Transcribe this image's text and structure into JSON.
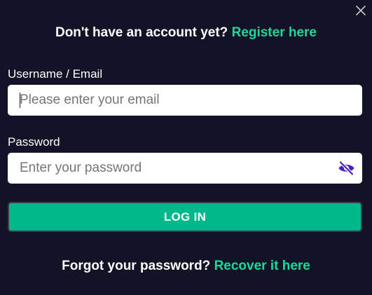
{
  "dialog": {
    "close_icon": "close-icon",
    "register_prompt": "Don't have an account yet?",
    "register_link": "Register here",
    "username_label": "Username / Email",
    "email_placeholder": "Please enter your email",
    "email_value": "",
    "password_label": "Password",
    "password_placeholder": "Enter your password",
    "password_value": "",
    "password_toggle_icon": "eye-off-icon",
    "login_label": "LOG IN",
    "forgot_prompt": "Forgot your password?",
    "recover_link": "Recover it here"
  },
  "colors": {
    "background": "#121327",
    "accent": "#1fd79a",
    "button": "#00b88a",
    "toggle_icon": "#4b1fb8",
    "text": "#ffffff"
  }
}
